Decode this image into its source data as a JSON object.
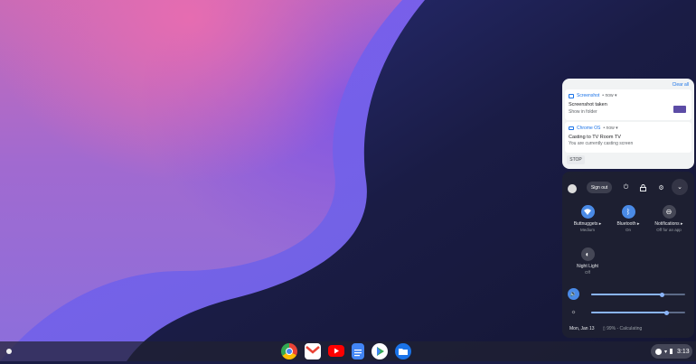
{
  "notifications": {
    "clear_all": "Clear all",
    "items": [
      {
        "source": "Screenshot",
        "when": "now",
        "title": "Screenshot taken",
        "body": "Show in folder",
        "icon": "image-icon"
      },
      {
        "source": "Chrome OS",
        "when": "now",
        "title": "Casting to TV Room TV",
        "body": "You are currently casting screen",
        "icon": "cast-icon"
      }
    ],
    "stop_label": "STOP"
  },
  "quick_settings": {
    "sign_out": "Sign out",
    "features": [
      {
        "label": "Buttnuggets",
        "sub": "Medium",
        "state": "on",
        "icon": "wifi-icon"
      },
      {
        "label": "Bluetooth",
        "sub": "On",
        "state": "on",
        "icon": "bluetooth-icon"
      },
      {
        "label": "Notifications",
        "sub": "Off for an app",
        "state": "off",
        "icon": "do-not-disturb-icon"
      },
      {
        "label": "Night Light",
        "sub": "Off",
        "state": "off",
        "icon": "night-light-icon"
      }
    ],
    "volume_level": 0.75,
    "brightness_level": 0.8,
    "date": "Mon, Jan 13",
    "battery": "99% - Calculating"
  },
  "shelf": {
    "apps": [
      {
        "name": "chrome-app-icon",
        "color": "#ea4335"
      },
      {
        "name": "gmail-app-icon",
        "color": "#ffffff"
      },
      {
        "name": "youtube-app-icon",
        "color": "#ff0000"
      },
      {
        "name": "docs-app-icon",
        "color": "#4285f4"
      },
      {
        "name": "play-store-app-icon",
        "color": "#ffffff"
      },
      {
        "name": "files-app-icon",
        "color": "#1a73e8"
      }
    ],
    "time": "3:13"
  },
  "colors": {
    "accent": "#4a8ae6",
    "link": "#1a73e8"
  }
}
